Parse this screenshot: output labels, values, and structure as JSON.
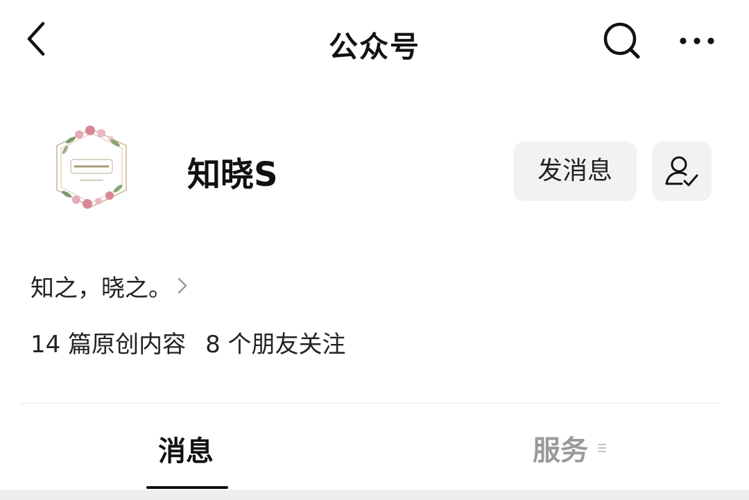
{
  "header": {
    "back_icon": "chevron-left-icon",
    "title": "公众号",
    "search_icon": "search-icon",
    "more_icon": "more-horizontal-icon"
  },
  "profile": {
    "name": "知晓S",
    "avatar_icon": "floral-wreath-logo",
    "message_button_label": "发消息",
    "follow_icon": "user-followed-icon"
  },
  "intro": {
    "text": "知之，晓之。",
    "chevron_icon": "chevron-right-icon"
  },
  "stats": {
    "original_articles": "14 篇原创内容",
    "friends_following": "8 个朋友关注"
  },
  "tabs": [
    {
      "label": "消息",
      "active": true
    },
    {
      "label": "服务",
      "active": false,
      "icon": "menu-lines-icon"
    }
  ],
  "colors": {
    "text_primary": "#111111",
    "tab_inactive": "#9a9a9a",
    "button_bg": "#f2f2f2"
  }
}
